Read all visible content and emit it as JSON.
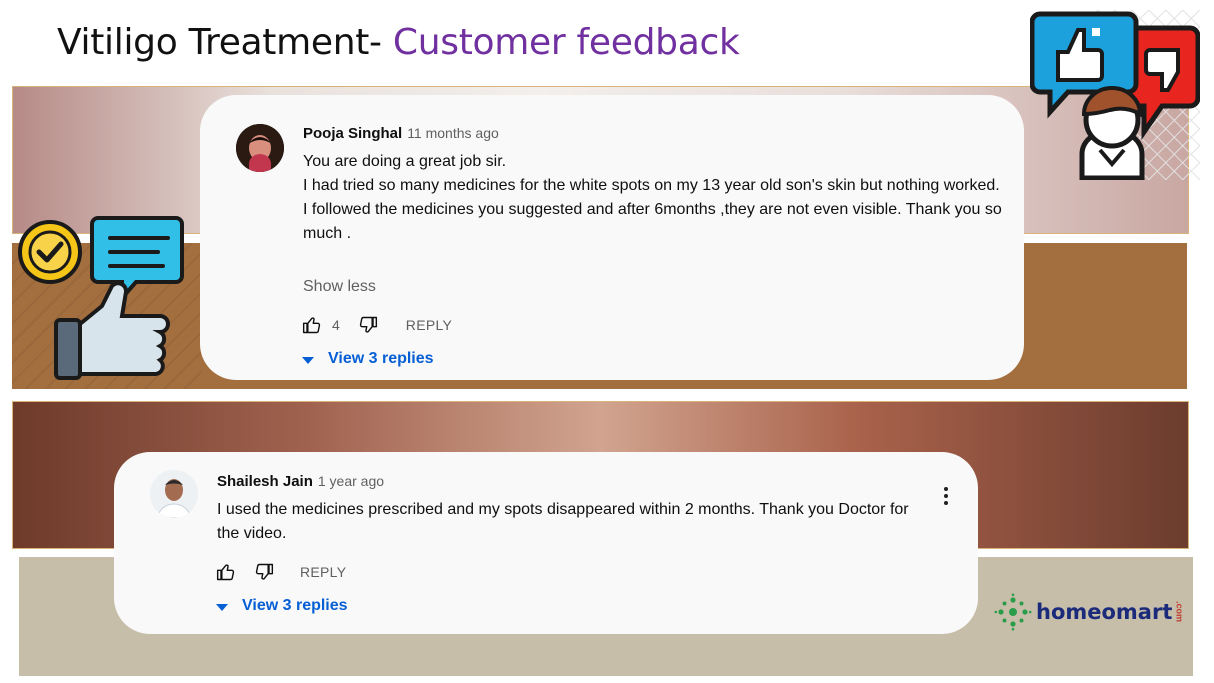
{
  "slide": {
    "title_main": "Vitiligo Treatment- ",
    "title_accent": "Customer feedback"
  },
  "comments": [
    {
      "author": "Pooja Singhal",
      "time": "11 months ago",
      "lines": [
        "You are doing a great job sir.",
        "I had tried so many medicines for the white spots on my 13 year old son's skin but nothing worked.",
        "I followed the medicines you suggested and after 6months  ,they are not even visible. Thank you so much ."
      ],
      "show_less": "Show less",
      "likes": "4",
      "reply_label": "REPLY",
      "view_replies": "View 3 replies"
    },
    {
      "author": "Shailesh Jain",
      "time": "1 year ago",
      "lines": [
        "I used the medicines prescribed and my spots disappeared within 2 months.  Thank you Doctor for the video."
      ],
      "reply_label": "REPLY",
      "view_replies": "View 3 replies"
    }
  ],
  "brand": {
    "name": "homeomart",
    "suffix": ".com"
  },
  "colors": {
    "accent": "#7030a0",
    "link": "#065fd4"
  },
  "icons": [
    "thumbs-up-icon",
    "thumbs-down-icon",
    "chevron-down-icon",
    "more-vert-icon",
    "speech-bubble-icon",
    "feedback-person-icon",
    "checkmark-icon"
  ]
}
